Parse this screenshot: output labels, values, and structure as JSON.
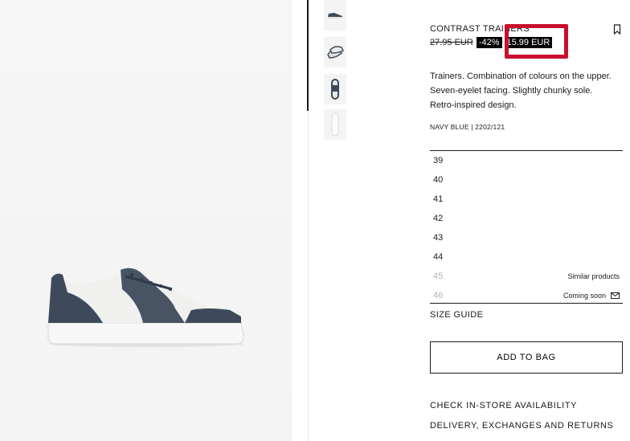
{
  "product": {
    "title": "CONTRAST TRAINERS",
    "old_price": "27.95 EUR",
    "discount": "-42%",
    "new_price": "15.99 EUR",
    "description": [
      "Trainers. Combination of colours on the upper.",
      "Seven-eyelet facing. Slightly chunky sole.",
      "Retro-inspired design."
    ],
    "color_ref": "NAVY BLUE | 2202/121"
  },
  "sizes": [
    {
      "label": "39",
      "note": ""
    },
    {
      "label": "40",
      "note": ""
    },
    {
      "label": "41",
      "note": ""
    },
    {
      "label": "42",
      "note": ""
    },
    {
      "label": "43",
      "note": ""
    },
    {
      "label": "44",
      "note": ""
    },
    {
      "label": "45",
      "note": "Similar products"
    },
    {
      "label": "46",
      "note": "Coming soon"
    }
  ],
  "actions": {
    "size_guide": "SIZE GUIDE",
    "add_to_bag": "ADD TO BAG",
    "check_store": "CHECK IN-STORE AVAILABILITY",
    "delivery": "DELIVERY, EXCHANGES AND RETURNS"
  },
  "icons": {
    "bookmark": "bookmark-icon",
    "mail": "mail-icon"
  },
  "colors": {
    "highlight": "#c8102e",
    "shoe_navy": "#3e4a5c"
  }
}
